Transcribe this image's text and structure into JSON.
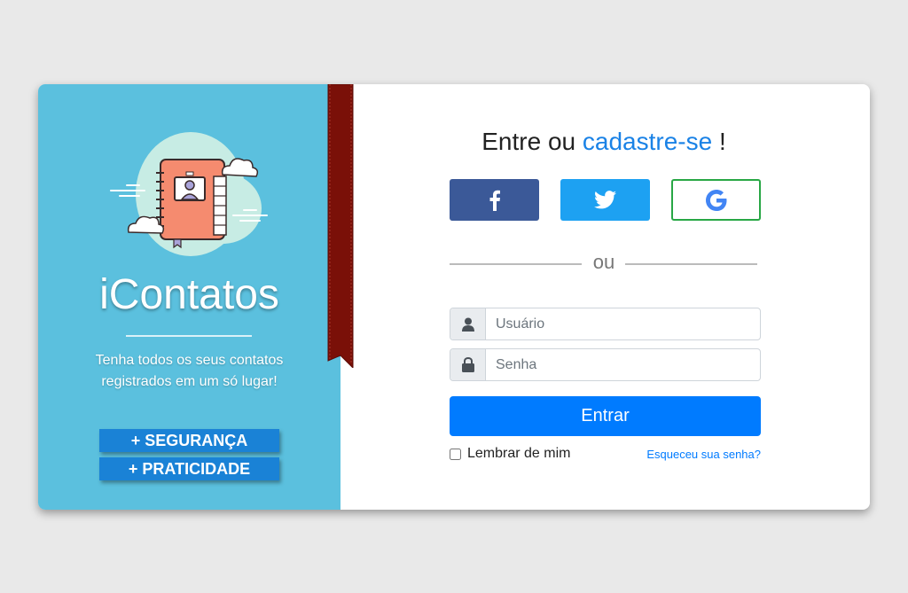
{
  "brand": {
    "name": "iContatos",
    "tagline": "Tenha todos os seus contatos registrados em um só lugar!",
    "features": [
      "+ SEGURANÇA",
      "+ PRATICIDADE"
    ]
  },
  "login": {
    "heading_prefix": "Entre ou",
    "heading_link": "cadastre-se",
    "heading_suffix": "!",
    "social": [
      {
        "name": "facebook",
        "icon": "facebook-icon",
        "color": "#3b5998"
      },
      {
        "name": "twitter",
        "icon": "twitter-icon",
        "color": "#1da1f2"
      },
      {
        "name": "google",
        "icon": "google-icon",
        "color": "#28a745"
      }
    ],
    "or_label": "ou",
    "username_placeholder": "Usuário",
    "password_placeholder": "Senha",
    "submit_label": "Entrar",
    "remember_label": "Lembrar de mim",
    "forgot_label": "Esqueceu sua senha?"
  },
  "colors": {
    "panel": "#5bc0de",
    "primary": "#007bff",
    "ribbon": "#7a1008",
    "feature_badge": "#1a82d6"
  }
}
